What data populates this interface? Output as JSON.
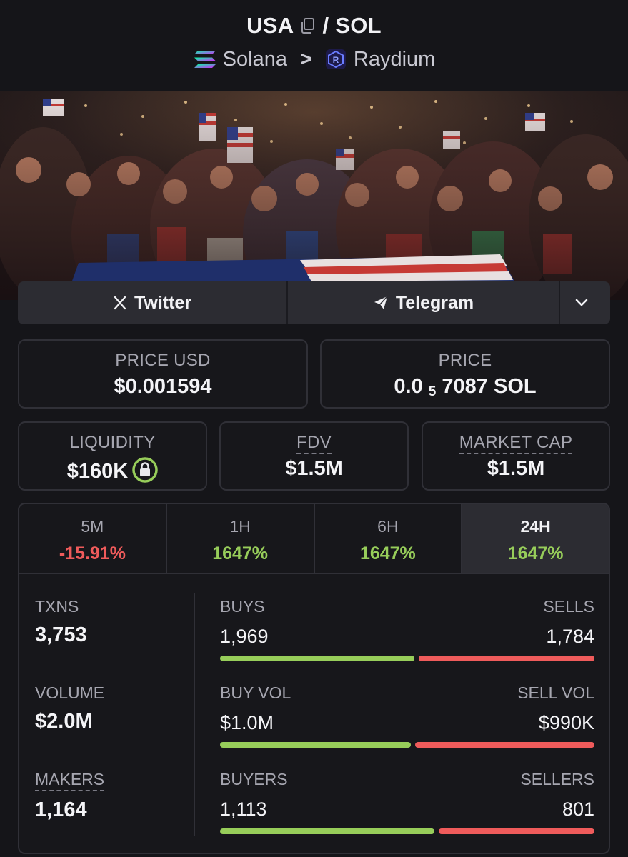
{
  "header": {
    "base": "USA",
    "separator": "/",
    "quote": "SOL",
    "copy_icon": "copy-icon",
    "chain": "Solana",
    "dex": "Raydium",
    "chevron": ">"
  },
  "social": {
    "twitter_label": "Twitter",
    "telegram_label": "Telegram",
    "more_icon": "chevron-down-icon"
  },
  "prices": {
    "usd_label": "PRICE USD",
    "usd_value": "$0.001594",
    "native_label": "PRICE",
    "native_value_prefix": "0.0",
    "native_value_sub": "5",
    "native_value_suffix": "7087 SOL"
  },
  "metrics": {
    "liquidity_label": "LIQUIDITY",
    "liquidity_value": "$160K",
    "fdv_label": "FDV",
    "fdv_value": "$1.5M",
    "mcap_label": "MARKET CAP",
    "mcap_value": "$1.5M"
  },
  "tabs": [
    {
      "label": "5M",
      "value": "-15.91%"
    },
    {
      "label": "1H",
      "value": "1647%"
    },
    {
      "label": "6H",
      "value": "1647%"
    },
    {
      "label": "24H",
      "value": "1647%"
    }
  ],
  "stats": {
    "txns_label": "TXNS",
    "txns_value": "3,753",
    "volume_label": "VOLUME",
    "volume_value": "$2.0M",
    "makers_label": "MAKERS",
    "makers_value": "1,164",
    "buys_label": "BUYS",
    "buys_value": "1,969",
    "sells_label": "SELLS",
    "sells_value": "1,784",
    "buyvol_label": "BUY VOL",
    "buyvol_value": "$1.0M",
    "sellvol_label": "SELL VOL",
    "sellvol_value": "$990K",
    "buyers_label": "BUYERS",
    "buyers_value": "1,113",
    "sellers_label": "SELLERS",
    "sellers_value": "801",
    "buy_share_txns": 0.525,
    "buy_share_vol": 0.515,
    "buy_share_makers": 0.58
  },
  "colors": {
    "positive": "#97cd5a",
    "negative": "#ef5b5b",
    "background": "#151519"
  }
}
